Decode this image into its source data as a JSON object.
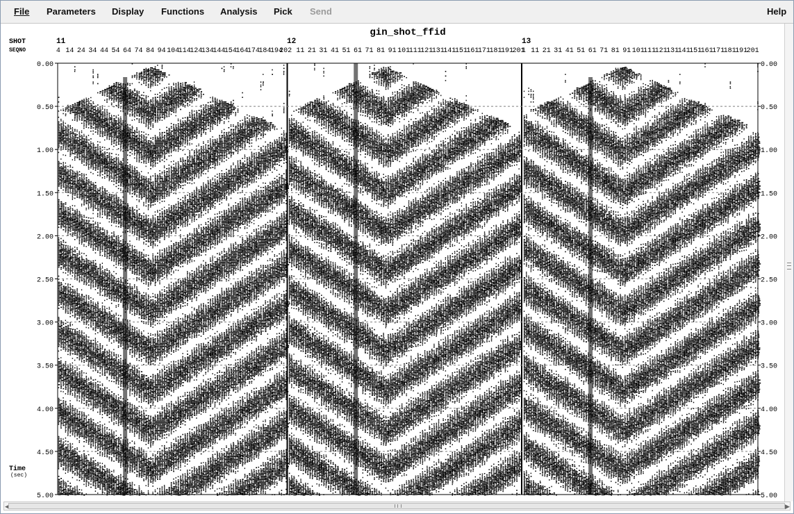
{
  "menu": {
    "file": "File",
    "parameters": "Parameters",
    "display": "Display",
    "functions": "Functions",
    "analysis": "Analysis",
    "pick": "Pick",
    "send": "Send",
    "help": "Help"
  },
  "plot": {
    "title": "gin_shot_ffid",
    "shot_header": "SHOT",
    "seqno_header": "SEQNO",
    "time_label": "Time",
    "time_unit": "(sec)",
    "time_ticks": [
      "0.00",
      "0.50",
      "1.00",
      "1.50",
      "2.00",
      "2.50",
      "3.00",
      "3.50",
      "4.00",
      "4.50",
      "5.00"
    ],
    "time_range": [
      0,
      5
    ],
    "shots": [
      {
        "label": "11",
        "seq_labels": [
          "4",
          "14",
          "24",
          "34",
          "44",
          "54",
          "64",
          "74",
          "84",
          "94",
          "104",
          "114",
          "124",
          "134",
          "144",
          "154",
          "164",
          "174",
          "184",
          "194",
          "202"
        ],
        "apex_seq": 84,
        "first_seq": 4,
        "last_seq": 202
      },
      {
        "label": "12",
        "seq_labels": [
          "11",
          "21",
          "31",
          "41",
          "51",
          "61",
          "71",
          "81",
          "91",
          "101",
          "111",
          "121",
          "131",
          "141",
          "151",
          "161",
          "171",
          "181",
          "191",
          "201"
        ],
        "apex_seq": 85,
        "first_seq": 1,
        "last_seq": 202
      },
      {
        "label": "13",
        "seq_labels": [
          "1",
          "11",
          "21",
          "31",
          "41",
          "51",
          "61",
          "71",
          "81",
          "91",
          "101",
          "111",
          "121",
          "131",
          "141",
          "151",
          "161",
          "171",
          "181",
          "191",
          "201"
        ],
        "apex_seq": 87,
        "first_seq": 1,
        "last_seq": 205
      }
    ],
    "colors": {
      "trace": "#000000",
      "background": "#ffffff",
      "grid": "#7f7f7f"
    },
    "grid": true
  }
}
